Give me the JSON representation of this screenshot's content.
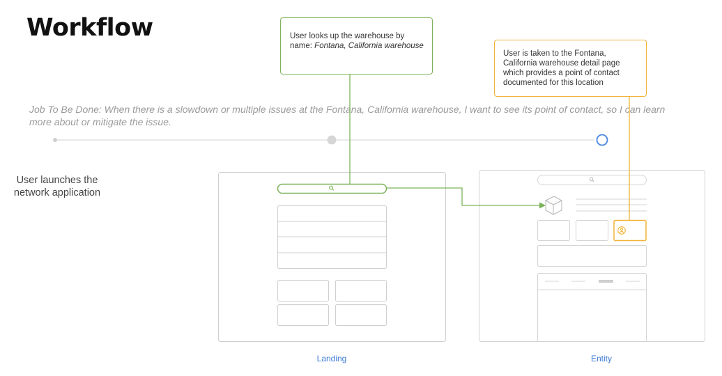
{
  "title": "Workflow",
  "job_to_be_done": "Job To Be Done: When there is a slowdown or multiple issues at the Fontana, California warehouse, I want to see its point of contact, so I can learn more about or mitigate the issue.",
  "step_launch": "User launches the network application",
  "callout_search": {
    "text_plain": "User looks up the warehouse by name: ",
    "text_italic": "Fontana, California warehouse"
  },
  "callout_entity": "User is taken to the Fontana, California warehouse detail page which provides a point of contact documented for this location",
  "pages": {
    "landing": "Landing",
    "entity": "Entity"
  },
  "colors": {
    "search_path": "#7cb35b",
    "contact_path": "#f2b337",
    "current_step": "#4a86e0",
    "wireframe": "#cfcfcf"
  },
  "icons": [
    "search-icon",
    "cube-icon",
    "contact-person-icon",
    "arrow-right-icon"
  ]
}
